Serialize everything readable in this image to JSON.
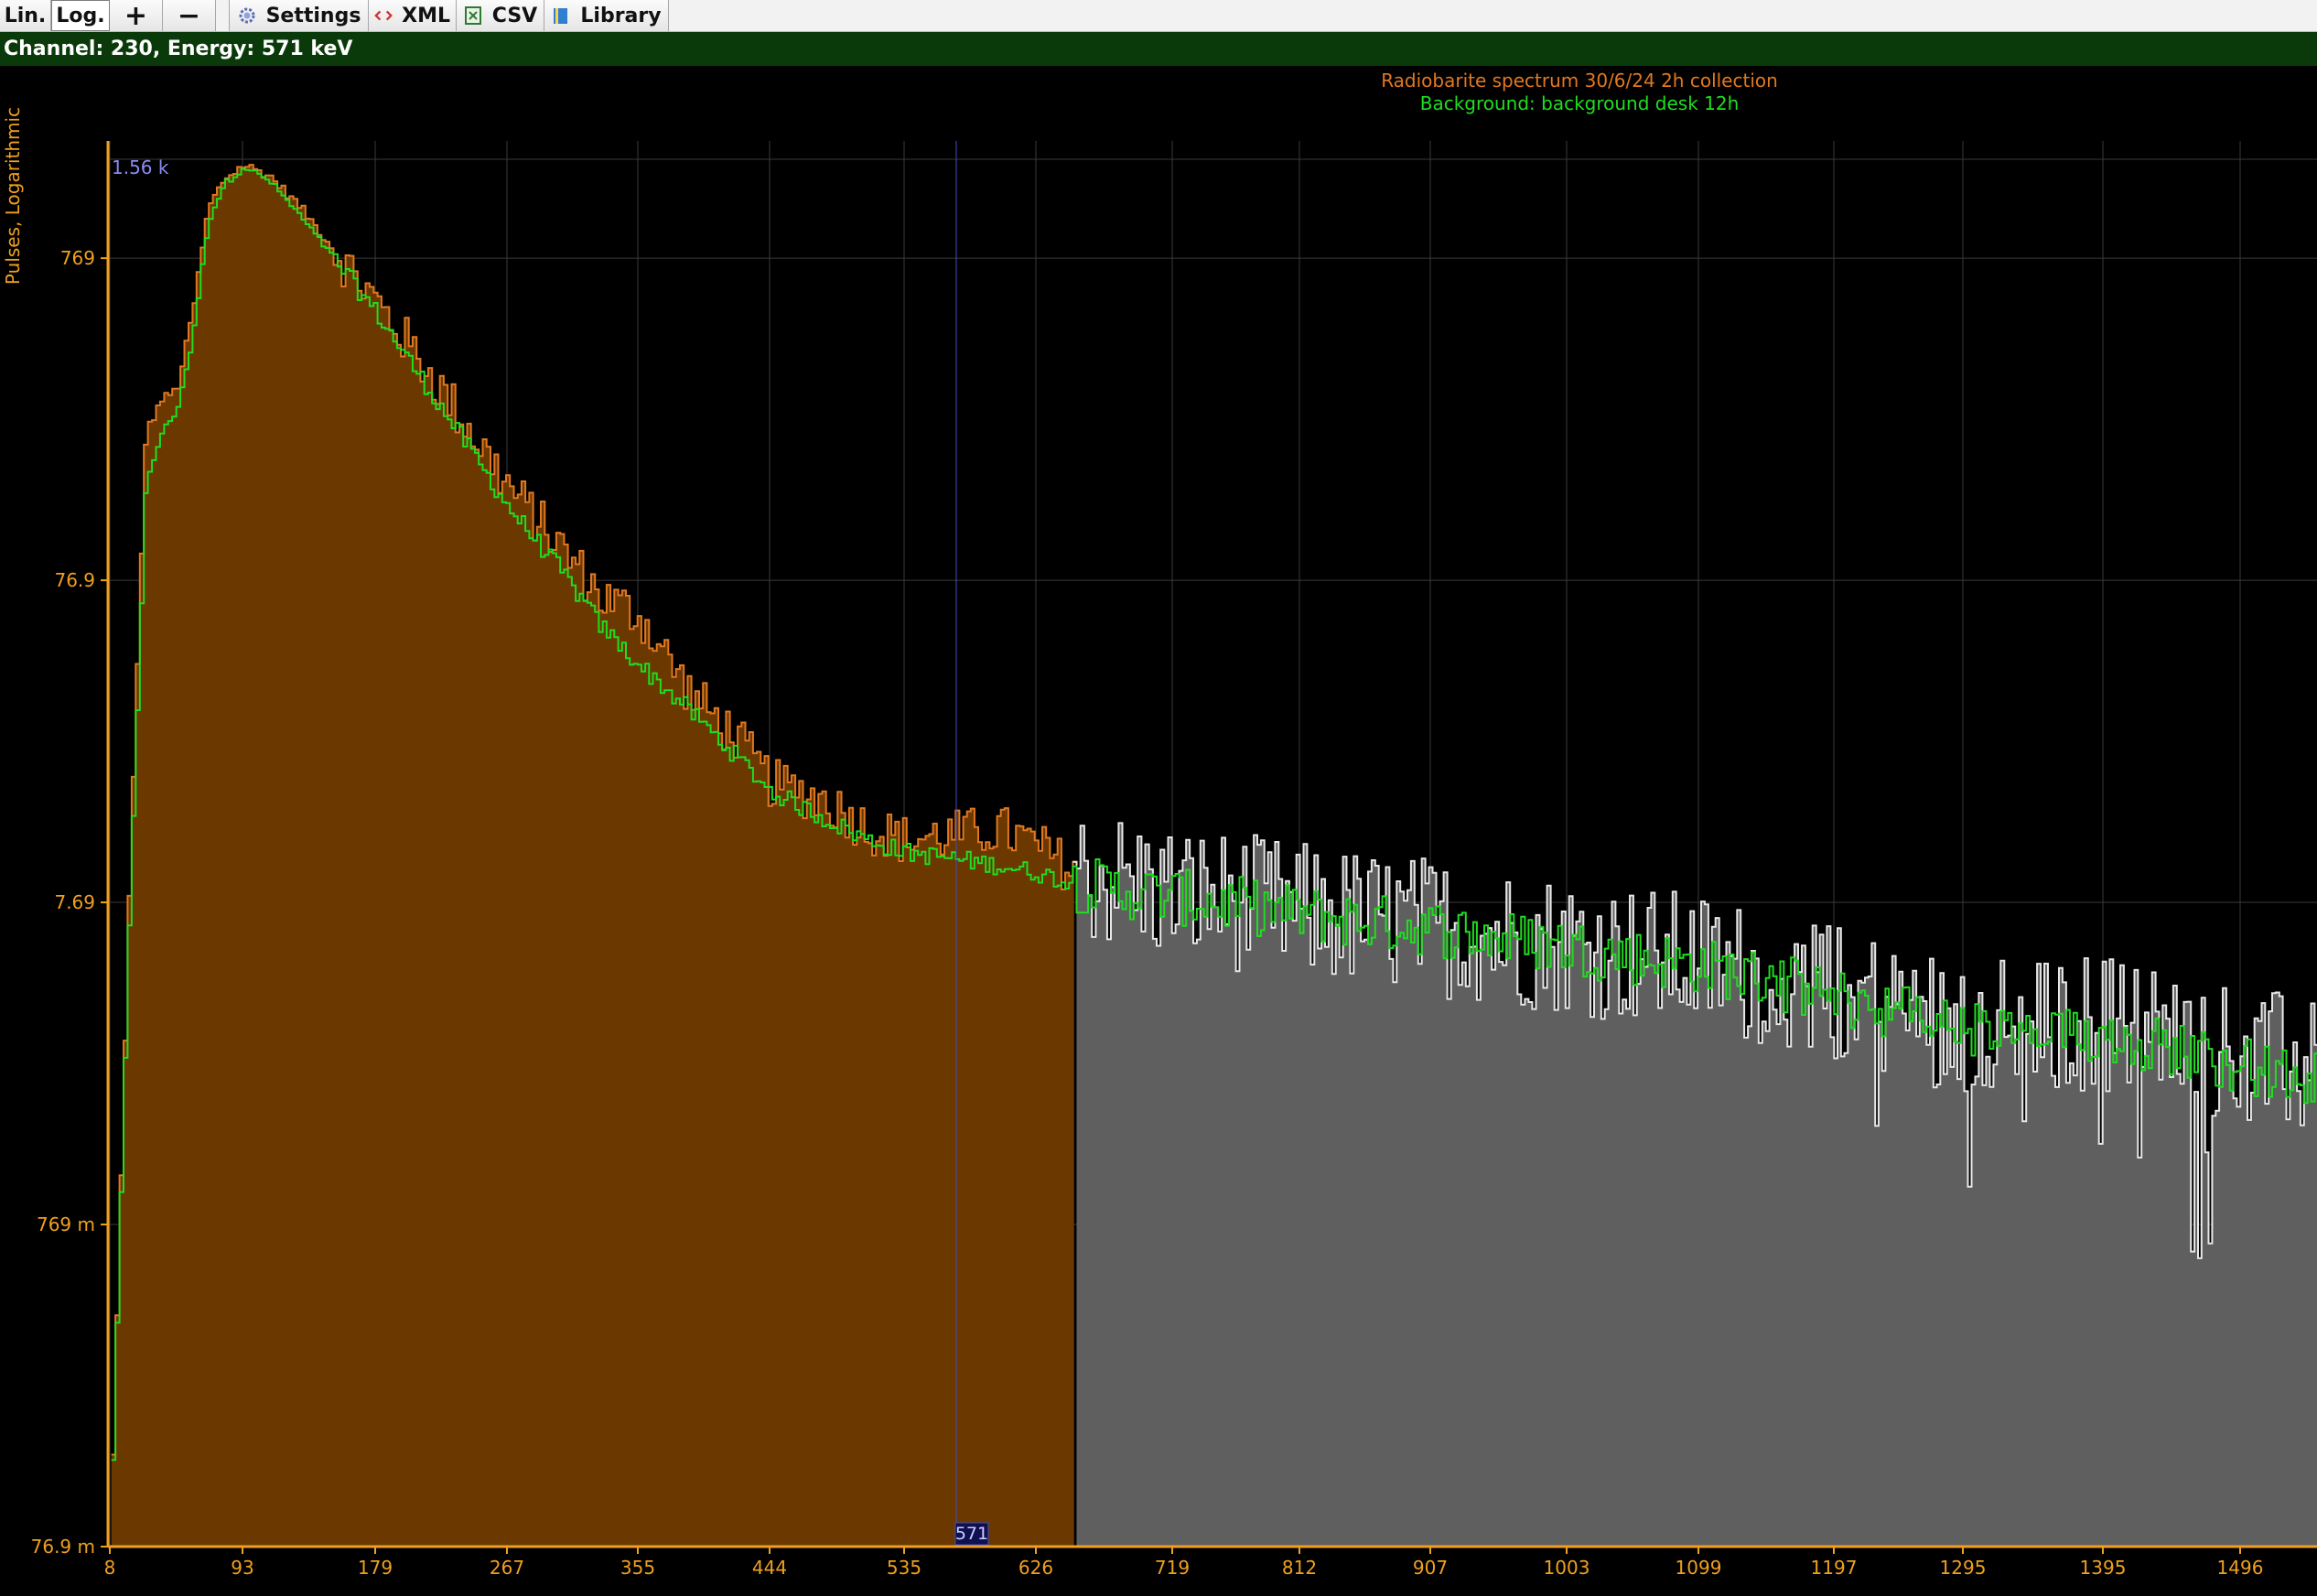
{
  "toolbar": {
    "lin_label": "Lin.",
    "log_label": "Log.",
    "zoom_in_label": "+",
    "zoom_out_label": "−",
    "settings_label": "Settings",
    "xml_label": "XML",
    "csv_label": "CSV",
    "library_label": "Library"
  },
  "status": {
    "text": "Channel: 230, Energy: 571 keV"
  },
  "colors": {
    "spectrum": "#e07820",
    "spectrum_fill": "#6b3800",
    "background_line": "#20dd20",
    "grey_fill": "#5f5f5f",
    "grey_line": "#e8e8e8",
    "axis": "#f0a020",
    "cursor": "#4050c0",
    "status_bg": "#0a3a0a"
  },
  "chart_data": {
    "type": "line",
    "title": "",
    "legend": [
      "Radiobarite spectrum 30/6/24 2h collection",
      "Background: background desk 12h"
    ],
    "legend_position": "top-center",
    "ylabel": "Pulses, Logarithmic",
    "yscale": "log",
    "ylim": [
      0.0769,
      1560
    ],
    "y_ticks": [
      "76.9 m",
      "769 m",
      "7.69",
      "76.9",
      "769"
    ],
    "y_tick_values": [
      0.0769,
      0.769,
      7.69,
      76.9,
      769
    ],
    "y_max_label": "1.56 k",
    "x_label": "",
    "xlim": [
      8,
      1560
    ],
    "x_ticks": [
      "8",
      "93",
      "179",
      "267",
      "355",
      "444",
      "535",
      "626",
      "719",
      "812",
      "907",
      "1003",
      "1099",
      "1197",
      "1295",
      "1395",
      "1496"
    ],
    "x_tick_values": [
      8,
      93,
      179,
      267,
      355,
      444,
      535,
      626,
      719,
      812,
      907,
      1003,
      1099,
      1197,
      1295,
      1395,
      1496
    ],
    "cursor_energy": 571,
    "cursor_label": "571",
    "selection_end_energy": 652,
    "grid": true,
    "series": [
      {
        "name": "Radiobarite spectrum 30/6/24 2h collection",
        "x": [
          8,
          20,
          30,
          40,
          50,
          60,
          70,
          80,
          93,
          110,
          130,
          150,
          179,
          210,
          240,
          267,
          300,
          330,
          355,
          390,
          420,
          444,
          480,
          510,
          535,
          570,
          600,
          626,
          652,
          680,
          719,
          760,
          812,
          860,
          907,
          950,
          1003,
          1050,
          1099,
          1150,
          1197,
          1250,
          1295,
          1350,
          1395,
          1450,
          1496,
          1530,
          1560
        ],
        "y": [
          0.1,
          10,
          220,
          280,
          300,
          520,
          1100,
          1350,
          1500,
          1380,
          1100,
          830,
          560,
          360,
          230,
          150,
          100,
          68,
          60,
          34,
          25,
          18,
          16,
          13,
          12,
          12.5,
          13,
          11.5,
          9.5,
          9,
          8.2,
          7.8,
          7.2,
          6.8,
          6.5,
          6.1,
          5.7,
          5.3,
          5.0,
          4.5,
          4.0,
          3.6,
          3.2,
          3.1,
          3.3,
          2.9,
          2.6,
          2.4,
          2.3
        ]
      },
      {
        "name": "Background: background desk 12h",
        "x": [
          8,
          20,
          30,
          40,
          50,
          60,
          70,
          80,
          93,
          110,
          130,
          150,
          179,
          210,
          240,
          267,
          300,
          330,
          355,
          390,
          420,
          444,
          480,
          510,
          535,
          570,
          600,
          626,
          652,
          680,
          719,
          760,
          812,
          860,
          907,
          950,
          1003,
          1050,
          1099,
          1150,
          1197,
          1250,
          1295,
          1350,
          1395,
          1450,
          1496,
          1530,
          1560
        ],
        "y": [
          0.1,
          8,
          150,
          220,
          260,
          430,
          1000,
          1300,
          1480,
          1330,
          1030,
          780,
          520,
          320,
          200,
          130,
          85,
          55,
          42,
          30,
          22,
          17,
          14,
          12,
          11,
          10.5,
          10,
          9.5,
          8.8,
          8.4,
          8.0,
          7.6,
          7.1,
          6.7,
          6.4,
          6.0,
          5.6,
          5.2,
          4.9,
          4.4,
          3.9,
          3.5,
          3.1,
          2.9,
          3.0,
          2.7,
          2.4,
          2.2,
          2.1
        ]
      }
    ]
  }
}
